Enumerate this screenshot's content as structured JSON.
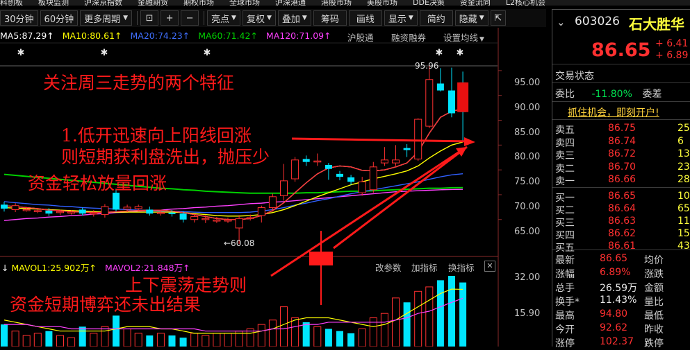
{
  "top_nav": {
    "items": [
      "科创板",
      "板块监测",
      "沪深京指数",
      "金融期货",
      "期权市场",
      "全球市场",
      "沪深港通",
      "港股市场",
      "美股市场",
      "DDE决策",
      "资金流向",
      "L2核心机会"
    ]
  },
  "toolbar": {
    "period_30": "30分钟",
    "period_60": "60分钟",
    "more_periods": "更多周期",
    "zoom_in": "+",
    "zoom_out": "−",
    "bright_spot": "亮点",
    "restore": "复权",
    "overlay": "叠加",
    "chips": "筹码",
    "draw": "画线",
    "display": "显示",
    "simple": "简约",
    "hide": "隐藏",
    "expand_icon": "⇱"
  },
  "ma_legend": {
    "ma5": "MA5:87.29↑",
    "ma10": "MA10:80.61↑",
    "ma20": "MA20:74.23↑",
    "ma60": "MA60:71.42↑",
    "ma120": "MA120:71.09↑",
    "hgt": "沪股通",
    "margin": "融资融券",
    "set_ma": "设置均线"
  },
  "price_axis": [
    "95.00",
    "90.00",
    "85.00",
    "80.00",
    "75.00",
    "70.00",
    "65.00"
  ],
  "high_label": "95.96",
  "low_label": "←60.08",
  "annotations": {
    "title": "关注周三走势的两个特征",
    "line1": "1.低开迅速向上阳线回涨",
    "line2": "则短期获利盘洗出，抛压少",
    "line3": "资金轻松放量回涨",
    "line4": "上下震荡走势则",
    "line5": "资金短期博弈还未出结果"
  },
  "volume_legend": {
    "mavol1": "MAVOL1:25.902万↑",
    "mavol2": "MAVOL2:21.848万↑",
    "change_param": "改参数",
    "add_indicator": "加指标",
    "switch_indicator": "换指标"
  },
  "volume_axis": [
    "32.00",
    "15.90"
  ],
  "quote": {
    "code": "603026",
    "name": "石大胜华",
    "price": "86.65",
    "change": "6.41",
    "change_pct": "6.89",
    "trade_status": "交易状态",
    "weibi_label": "委比",
    "weibi_value": "-11.80%",
    "weicha_label": "委差",
    "promo": "抓住机会，即刻开户!",
    "sell": [
      {
        "label": "卖五",
        "price": "86.75",
        "vol": "25"
      },
      {
        "label": "卖四",
        "price": "86.74",
        "vol": "6"
      },
      {
        "label": "卖三",
        "price": "86.72",
        "vol": "13"
      },
      {
        "label": "卖二",
        "price": "86.70",
        "vol": "23"
      },
      {
        "label": "卖一",
        "price": "86.66",
        "vol": "288"
      }
    ],
    "buy": [
      {
        "label": "买一",
        "price": "86.65",
        "vol": "108"
      },
      {
        "label": "买二",
        "price": "86.64",
        "vol": "65"
      },
      {
        "label": "买三",
        "price": "86.63",
        "vol": "11"
      },
      {
        "label": "买四",
        "price": "86.62",
        "vol": "15"
      },
      {
        "label": "买五",
        "price": "86.61",
        "vol": "43"
      }
    ],
    "stats": [
      {
        "l1": "最新",
        "v1": "86.65",
        "l2": "均价"
      },
      {
        "l1": "涨幅",
        "v1": "6.89%",
        "l2": "涨跌"
      },
      {
        "l1": "总手",
        "v1": "26.59万",
        "l2": "金额"
      },
      {
        "l1": "换手*",
        "v1": "11.43%",
        "l2": "量比"
      },
      {
        "l1": "最高",
        "v1": "94.80",
        "l2": "最低"
      },
      {
        "l1": "今开",
        "v1": "92.62",
        "l2": "昨收"
      },
      {
        "l1": "涨停",
        "v1": "102.37",
        "l2": "跌停"
      }
    ]
  },
  "colors": {
    "up": "#ff3030",
    "down": "#00e5ff",
    "ma5": "#ffffff",
    "ma10": "#ffff00",
    "ma20": "#3060ff",
    "ma60": "#00d000",
    "ma120": "#ff40ff",
    "annotation": "#ff1a1a"
  },
  "chart_data": {
    "type": "candlestick",
    "ylim": [
      60.08,
      95.96
    ],
    "candles": [
      {
        "o": 68.0,
        "c": 67.2,
        "h": 68.6,
        "l": 66.6
      },
      {
        "o": 67.0,
        "c": 67.8,
        "h": 68.3,
        "l": 66.5
      },
      {
        "o": 66.9,
        "c": 67.0,
        "h": 67.5,
        "l": 66.6
      },
      {
        "o": 66.8,
        "c": 66.8,
        "h": 67.3,
        "l": 66.3
      },
      {
        "o": 66.8,
        "c": 66.2,
        "h": 67.3,
        "l": 65.7
      },
      {
        "o": 66.4,
        "c": 66.6,
        "h": 67.0,
        "l": 65.9
      },
      {
        "o": 66.5,
        "c": 66.5,
        "h": 66.9,
        "l": 66.0
      },
      {
        "o": 67.0,
        "c": 66.2,
        "h": 67.4,
        "l": 65.8
      },
      {
        "o": 66.3,
        "c": 66.3,
        "h": 66.9,
        "l": 65.6
      },
      {
        "o": 66.0,
        "c": 67.6,
        "h": 68.1,
        "l": 65.4
      },
      {
        "o": 70.4,
        "c": 67.0,
        "h": 71.2,
        "l": 66.6
      },
      {
        "o": 67.1,
        "c": 67.5,
        "h": 68.0,
        "l": 66.5
      },
      {
        "o": 67.2,
        "c": 67.6,
        "h": 68.0,
        "l": 66.6
      },
      {
        "o": 67.0,
        "c": 66.2,
        "h": 67.6,
        "l": 65.8
      },
      {
        "o": 66.4,
        "c": 66.4,
        "h": 66.9,
        "l": 65.8
      },
      {
        "o": 66.4,
        "c": 66.1,
        "h": 66.9,
        "l": 65.6
      },
      {
        "o": 66.2,
        "c": 65.0,
        "h": 66.7,
        "l": 64.4
      },
      {
        "o": 65.0,
        "c": 65.6,
        "h": 66.0,
        "l": 64.4
      },
      {
        "o": 65.2,
        "c": 65.2,
        "h": 65.8,
        "l": 64.3
      },
      {
        "o": 64.9,
        "c": 64.9,
        "h": 65.5,
        "l": 64.3
      },
      {
        "o": 64.9,
        "c": 64.9,
        "h": 65.4,
        "l": 64.3
      },
      {
        "o": 63.3,
        "c": 65.2,
        "h": 65.9,
        "l": 60.08
      },
      {
        "o": 65.4,
        "c": 65.4,
        "h": 66.0,
        "l": 64.8
      },
      {
        "o": 65.8,
        "c": 67.4,
        "h": 67.8,
        "l": 64.4
      },
      {
        "o": 67.4,
        "c": 69.6,
        "h": 70.2,
        "l": 66.6
      },
      {
        "o": 69.8,
        "c": 72.8,
        "h": 76.2,
        "l": 68.8
      },
      {
        "o": 73.2,
        "c": 77.0,
        "h": 77.6,
        "l": 72.6
      },
      {
        "o": 77.2,
        "c": 76.6,
        "h": 77.9,
        "l": 75.8
      },
      {
        "o": 76.8,
        "c": 76.8,
        "h": 78.3,
        "l": 75.8
      },
      {
        "o": 76.0,
        "c": 75.2,
        "h": 76.4,
        "l": 73.0
      },
      {
        "o": 74.2,
        "c": 73.6,
        "h": 74.8,
        "l": 72.9
      },
      {
        "o": 73.5,
        "c": 72.6,
        "h": 74.0,
        "l": 72.0
      },
      {
        "o": 70.4,
        "c": 72.6,
        "h": 73.6,
        "l": 69.8
      },
      {
        "o": 71.0,
        "c": 75.6,
        "h": 76.6,
        "l": 70.4
      },
      {
        "o": 76.4,
        "c": 77.0,
        "h": 79.6,
        "l": 75.8
      },
      {
        "o": 76.4,
        "c": 77.0,
        "h": 80.0,
        "l": 75.8
      },
      {
        "o": 79.4,
        "c": 79.0,
        "h": 80.2,
        "l": 77.6
      },
      {
        "o": 77.2,
        "c": 85.2,
        "h": 85.4,
        "l": 76.8
      },
      {
        "o": 83.8,
        "c": 93.2,
        "h": 95.96,
        "l": 83.4
      },
      {
        "o": 92.4,
        "c": 91.0,
        "h": 95.5,
        "l": 90.8
      },
      {
        "o": 91.0,
        "c": 86.4,
        "h": 95.6,
        "l": 85.6
      },
      {
        "o": 92.62,
        "c": 86.65,
        "h": 94.8,
        "l": 80.8
      }
    ],
    "ma5": [
      67.8,
      67.6,
      67.4,
      67.2,
      66.9,
      66.8,
      66.6,
      66.5,
      66.4,
      66.4,
      66.6,
      66.7,
      66.8,
      66.9,
      66.9,
      66.7,
      66.4,
      66.0,
      65.6,
      65.2,
      65.0,
      65.0,
      65.2,
      65.8,
      66.8,
      68.4,
      70.4,
      72.4,
      74.2,
      75.4,
      75.8,
      75.6,
      74.9,
      74.8,
      75.0,
      75.6,
      76.4,
      78.6,
      82.4,
      85.6,
      86.8,
      87.29
    ],
    "ma10": [
      67.4,
      67.3,
      67.2,
      67.1,
      67.0,
      66.9,
      66.8,
      66.7,
      66.6,
      66.5,
      66.5,
      66.5,
      66.5,
      66.5,
      66.5,
      66.5,
      66.4,
      66.2,
      66.0,
      65.8,
      65.7,
      65.7,
      65.8,
      66.0,
      66.4,
      67.0,
      67.8,
      68.7,
      69.6,
      70.4,
      71.2,
      72.0,
      72.6,
      73.2,
      73.7,
      74.2,
      74.8,
      75.8,
      77.4,
      78.8,
      80.0,
      80.61
    ],
    "ma20": [
      68.6,
      68.4,
      68.2,
      68.0,
      67.9,
      67.7,
      67.6,
      67.4,
      67.3,
      67.2,
      67.1,
      67.0,
      66.9,
      66.8,
      66.7,
      66.7,
      66.6,
      66.5,
      66.4,
      66.4,
      66.4,
      66.4,
      66.5,
      66.7,
      67.0,
      67.4,
      67.9,
      68.3,
      68.8,
      69.2,
      69.7,
      70.2,
      70.6,
      71.0,
      71.4,
      71.8,
      72.2,
      72.6,
      73.1,
      73.6,
      74.0,
      74.23
    ],
    "ma60": [
      74.1,
      73.9,
      73.7,
      73.5,
      73.3,
      73.1,
      72.9,
      72.7,
      72.5,
      72.3,
      72.1,
      71.9,
      71.7,
      71.5,
      71.3,
      71.2,
      71.0,
      70.9,
      70.7,
      70.6,
      70.5,
      70.4,
      70.3,
      70.3,
      70.3,
      70.3,
      70.3,
      70.4,
      70.4,
      70.5,
      70.6,
      70.7,
      70.7,
      70.8,
      70.9,
      71.0,
      71.1,
      71.2,
      71.3,
      71.3,
      71.4,
      71.42
    ],
    "ma120": [
      64.8,
      65.0,
      65.2,
      65.3,
      65.5,
      65.6,
      65.8,
      65.9,
      66.1,
      66.2,
      66.4,
      66.5,
      66.7,
      66.8,
      66.9,
      67.1,
      67.2,
      67.4,
      67.5,
      67.7,
      67.8,
      68.0,
      68.2,
      68.3,
      68.5,
      68.6,
      68.8,
      69.0,
      69.2,
      69.4,
      69.6,
      69.8,
      70.0,
      70.2,
      70.4,
      70.6,
      70.7,
      70.8,
      70.9,
      71.0,
      71.05,
      71.09
    ],
    "volume": {
      "ylim": [
        0,
        32.0
      ],
      "values": [
        10,
        7,
        5,
        6,
        7,
        5,
        4,
        9,
        6,
        9,
        14,
        8,
        6,
        5,
        6,
        5,
        4,
        6,
        5,
        6,
        6,
        7,
        8,
        10,
        12,
        18,
        13,
        11,
        9,
        8,
        7,
        6,
        8,
        13,
        15,
        22,
        20,
        25,
        27,
        30,
        32,
        29
      ],
      "mavol1": [
        12,
        11,
        10,
        9,
        8,
        7,
        7,
        7,
        7,
        7,
        8,
        9,
        9,
        9,
        8,
        8,
        7,
        6,
        6,
        6,
        6,
        6,
        6,
        7,
        8,
        10,
        12,
        13,
        13,
        13,
        12,
        11,
        10,
        9,
        10,
        12,
        15,
        18,
        21,
        24,
        26,
        25.902
      ],
      "mavol2": [
        10,
        10,
        10,
        9,
        9,
        9,
        8,
        8,
        8,
        8,
        8,
        8,
        8,
        8,
        8,
        8,
        8,
        8,
        7,
        7,
        7,
        7,
        7,
        7,
        8,
        8,
        9,
        10,
        10,
        11,
        11,
        11,
        11,
        11,
        11,
        12,
        13,
        15,
        16,
        18,
        20,
        21.848
      ]
    }
  }
}
